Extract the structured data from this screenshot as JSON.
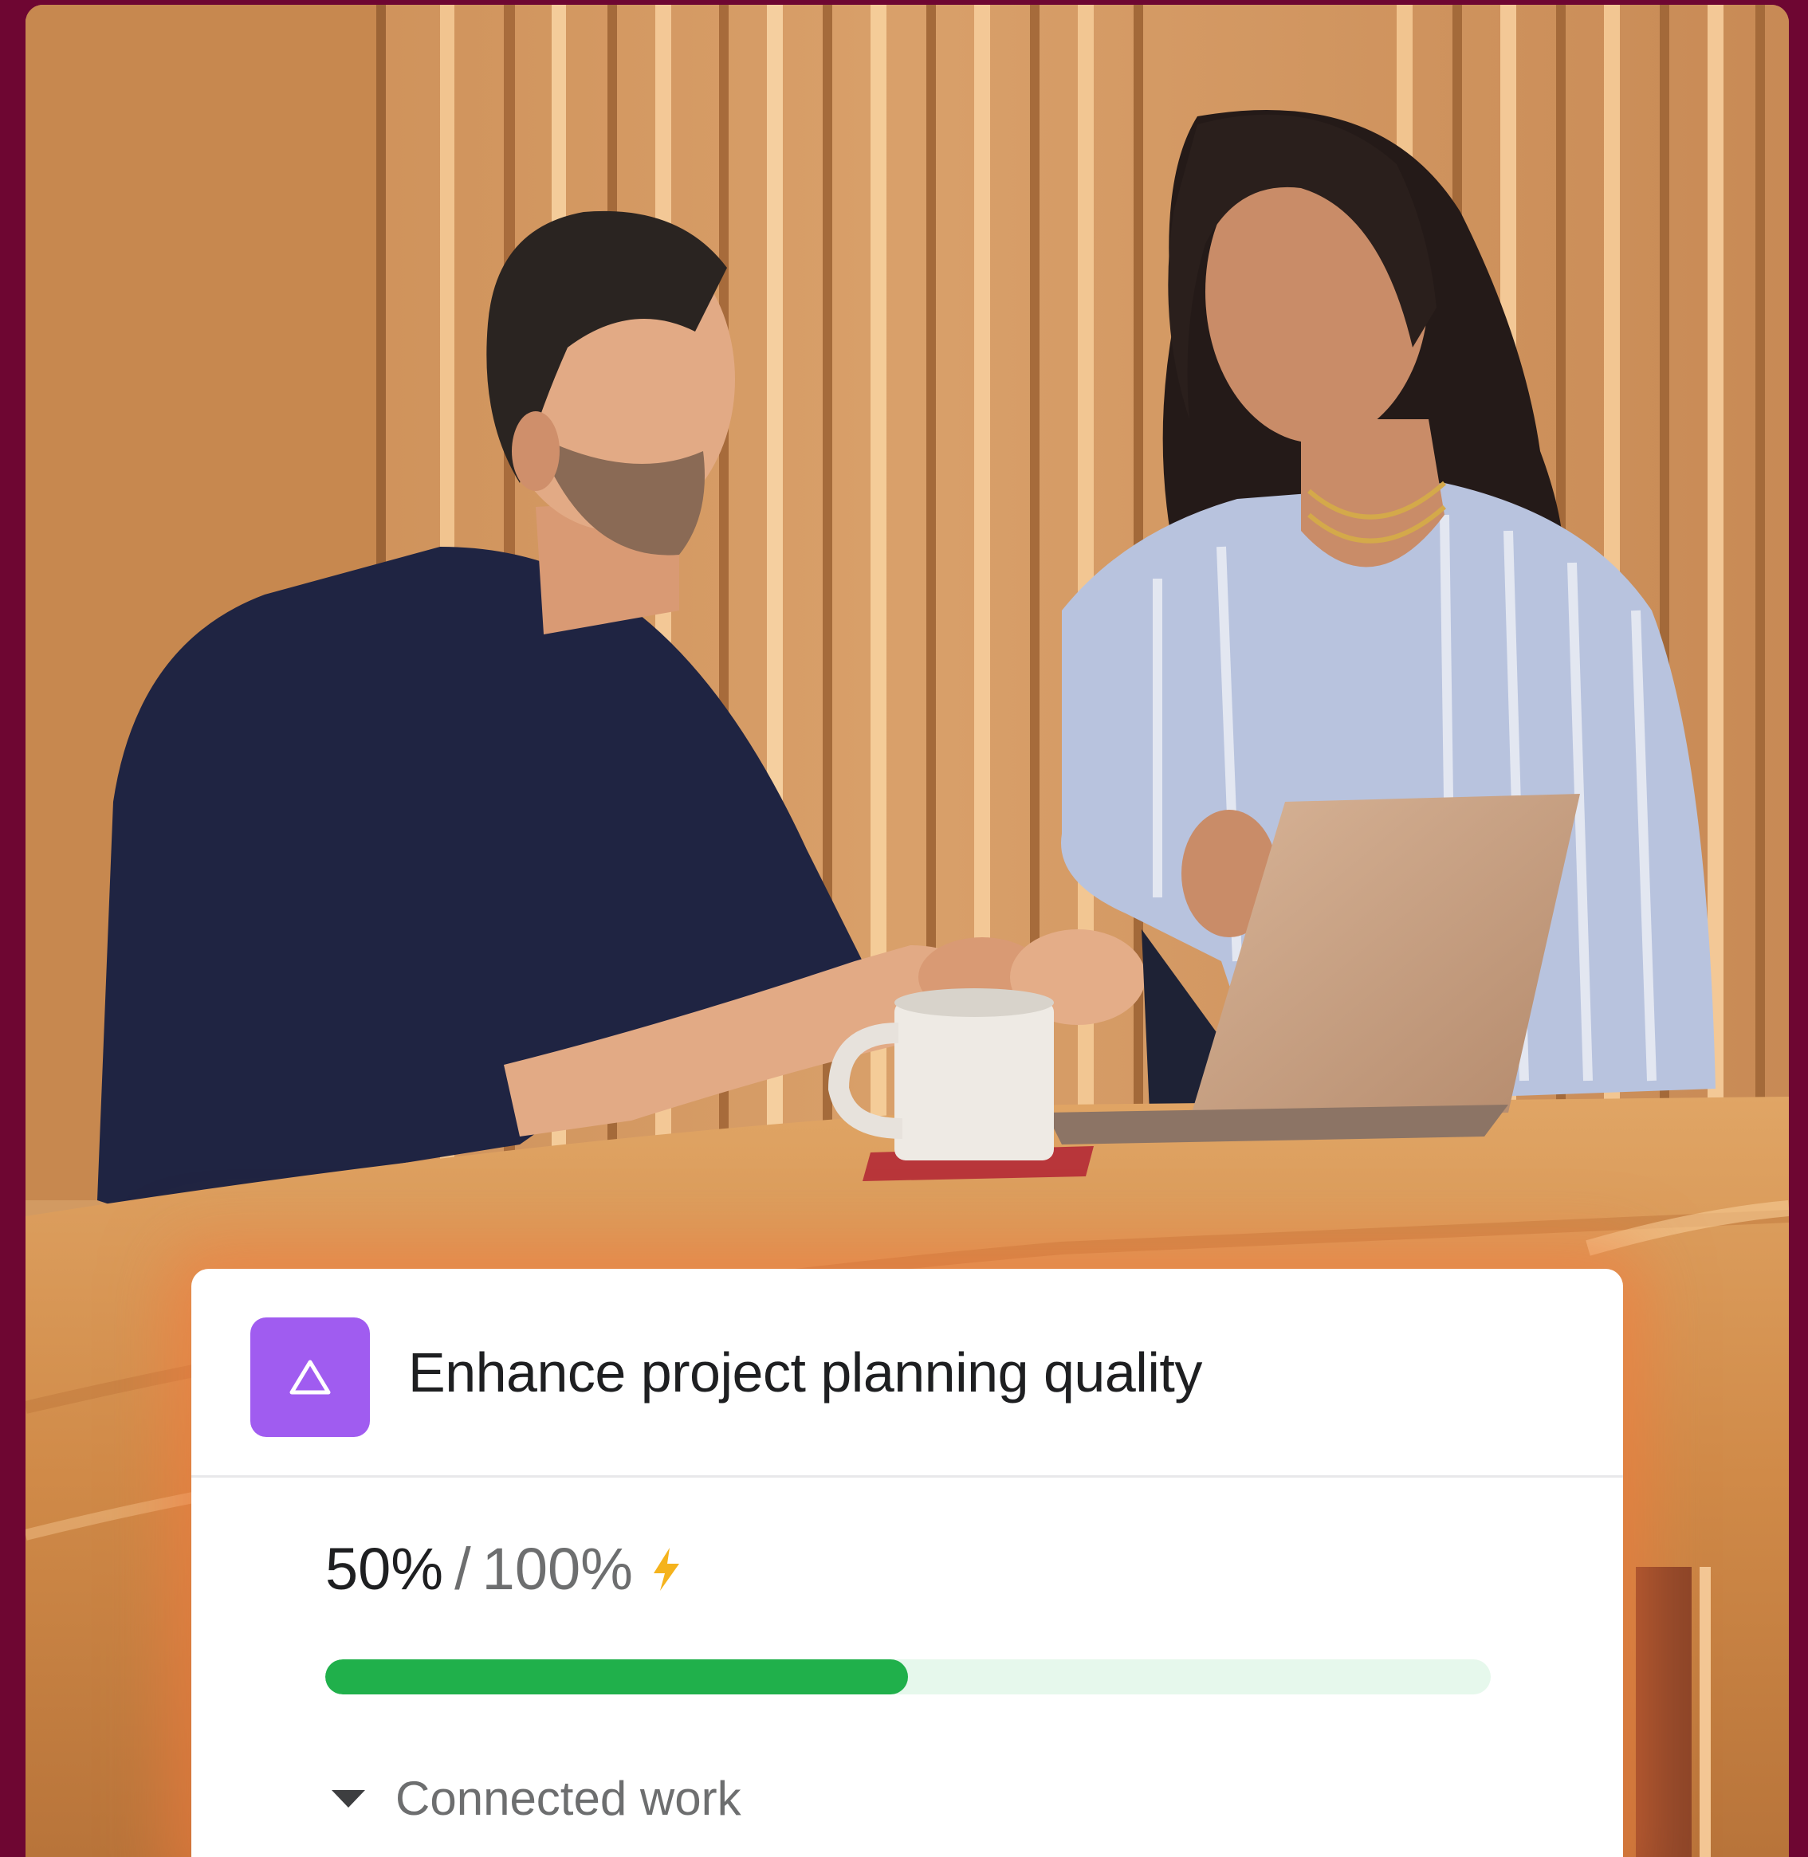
{
  "goal": {
    "title": "Enhance project planning quality",
    "icon": "triangle-goal-icon",
    "icon_color": "#a05cf0"
  },
  "progress": {
    "current": "50%",
    "separator": "/",
    "target": "100%",
    "fraction": 0.5,
    "status_icon": "lightning-bolt-icon",
    "bar_color": "#20b04b",
    "track_color": "#e6f8ec"
  },
  "connected_work": {
    "label": "Connected work",
    "toggle_icon": "caret-down-icon"
  },
  "colors": {
    "page_background": "#6e0632",
    "bolt": "#f5b31d"
  }
}
